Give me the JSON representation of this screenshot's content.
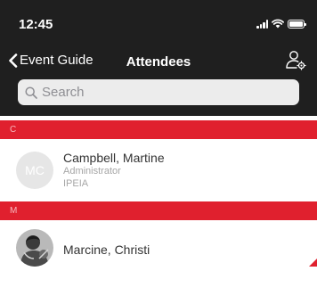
{
  "status_bar": {
    "time": "12:45"
  },
  "nav": {
    "back_label": "Event Guide",
    "title": "Attendees"
  },
  "search": {
    "placeholder": "Search",
    "value": ""
  },
  "sections": [
    {
      "letter": "C",
      "attendees": [
        {
          "initials": "MC",
          "name": "Campbell, Martine",
          "role": "Administrator",
          "organization": "IPEIA"
        }
      ]
    },
    {
      "letter": "M",
      "attendees": [
        {
          "name": "Marcine, Christi"
        }
      ]
    }
  ],
  "colors": {
    "nav_background": "#1f1f1f",
    "accent": "#e0202e",
    "search_background": "#ececec",
    "avatar_placeholder": "#e6e6e6"
  },
  "icons": {
    "back": "chevron-left-icon",
    "user_settings": "user-gear-icon",
    "search": "search-icon",
    "signal": "cell-signal-icon",
    "wifi": "wifi-icon",
    "battery": "battery-icon"
  }
}
